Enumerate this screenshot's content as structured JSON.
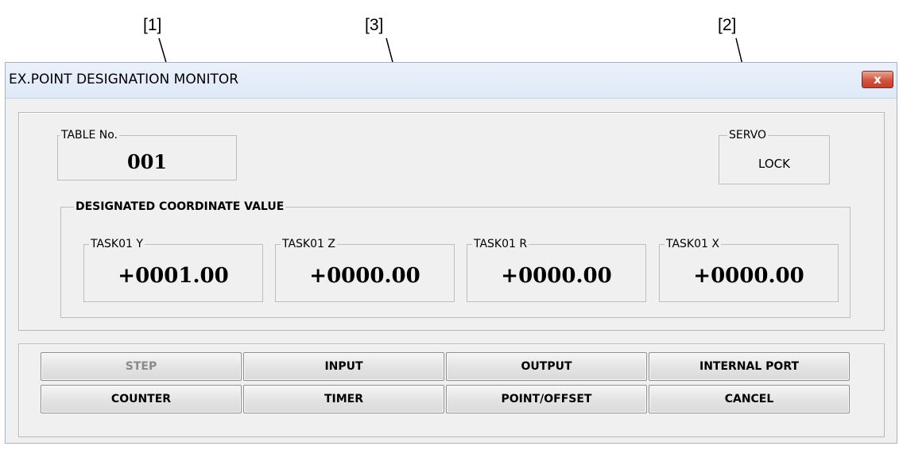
{
  "callouts": [
    "[1]",
    "[3]",
    "[2]"
  ],
  "window": {
    "title": "EX.POINT DESIGNATION MONITOR",
    "close_glyph": "x"
  },
  "table": {
    "label": "TABLE No.",
    "value": "001"
  },
  "servo": {
    "label": "SERVO",
    "value": "LOCK"
  },
  "coordinates": {
    "label": "DESIGNATED COORDINATE VALUE",
    "fields": [
      {
        "label": "TASK01 Y",
        "value": "+0001.00"
      },
      {
        "label": "TASK01 Z",
        "value": "+0000.00"
      },
      {
        "label": "TASK01 R",
        "value": "+0000.00"
      },
      {
        "label": "TASK01 X",
        "value": "+0000.00"
      }
    ]
  },
  "buttons": [
    {
      "label": "STEP",
      "enabled": false
    },
    {
      "label": "INPUT",
      "enabled": true
    },
    {
      "label": "OUTPUT",
      "enabled": true
    },
    {
      "label": "INTERNAL PORT",
      "enabled": true
    },
    {
      "label": "COUNTER",
      "enabled": true
    },
    {
      "label": "TIMER",
      "enabled": true
    },
    {
      "label": "POINT/OFFSET",
      "enabled": true
    },
    {
      "label": "CANCEL",
      "enabled": true
    }
  ]
}
